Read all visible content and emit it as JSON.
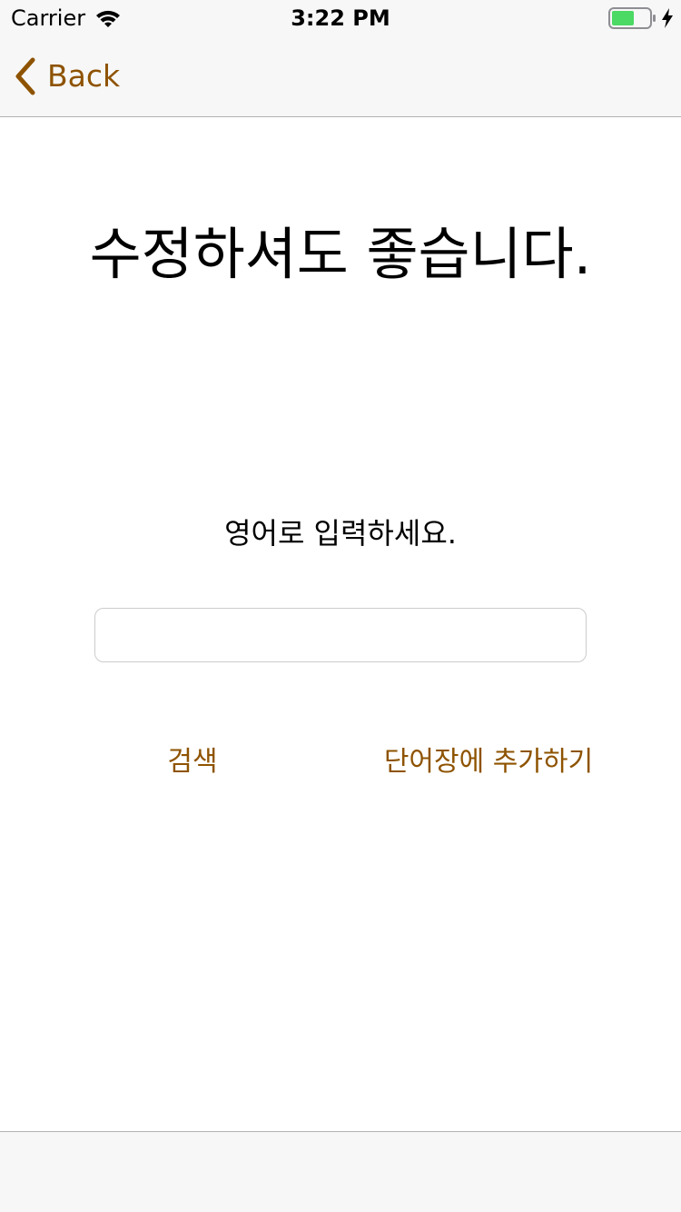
{
  "status_bar": {
    "carrier": "Carrier",
    "time": "3:22 PM",
    "battery_color": "#4cd964"
  },
  "nav": {
    "back_label": "Back",
    "tint_color": "#8e5300"
  },
  "content": {
    "headline": "수정하셔도 좋습니다.",
    "instruction": "영어로 입력하세요.",
    "input_value": "",
    "search_label": "검색",
    "add_label": "단어장에 추가하기"
  }
}
